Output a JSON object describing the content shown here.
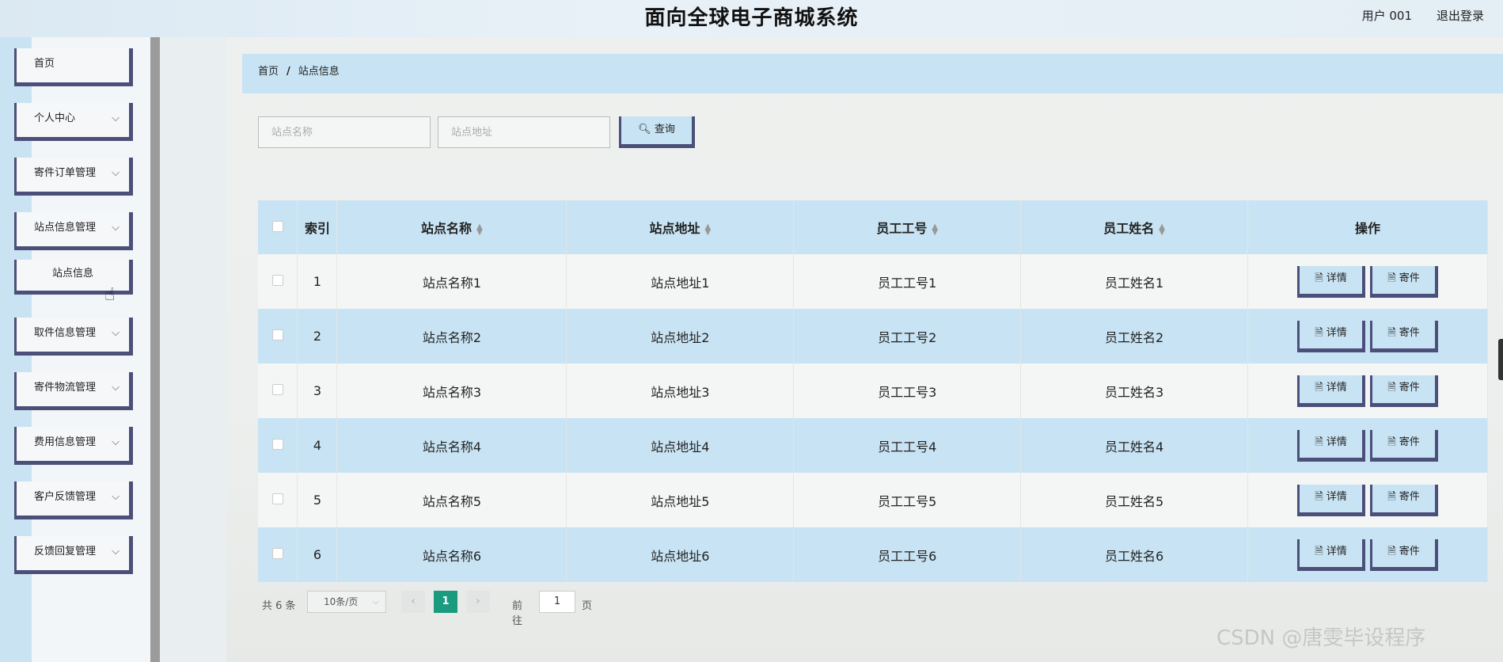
{
  "header": {
    "title": "面向全球电子商城系统",
    "user": "用户 001",
    "logout": "退出登录"
  },
  "sidebar": {
    "items": [
      {
        "label": "首页",
        "has_chevron": false
      },
      {
        "label": "个人中心",
        "has_chevron": true
      },
      {
        "label": "寄件订单管理",
        "has_chevron": true
      },
      {
        "label": "站点信息管理",
        "has_chevron": true
      },
      {
        "label": "站点信息",
        "sub": true
      },
      {
        "label": "取件信息管理",
        "has_chevron": true
      },
      {
        "label": "寄件物流管理",
        "has_chevron": true
      },
      {
        "label": "费用信息管理",
        "has_chevron": true
      },
      {
        "label": "客户反馈管理",
        "has_chevron": true
      },
      {
        "label": "反馈回复管理",
        "has_chevron": true
      }
    ]
  },
  "breadcrumb": {
    "home": "首页",
    "separator": "/",
    "current": "站点信息"
  },
  "search": {
    "name_placeholder": "站点名称",
    "address_placeholder": "站点地址",
    "query_label": "查询"
  },
  "table": {
    "headers": {
      "index": "索引",
      "name": "站点名称",
      "address": "站点地址",
      "staff_no": "员工工号",
      "staff_name": "员工姓名",
      "ops": "操作"
    },
    "rows": [
      {
        "index": "1",
        "name": "站点名称1",
        "address": "站点地址1",
        "staff_no": "员工工号1",
        "staff_name": "员工姓名1"
      },
      {
        "index": "2",
        "name": "站点名称2",
        "address": "站点地址2",
        "staff_no": "员工工号2",
        "staff_name": "员工姓名2"
      },
      {
        "index": "3",
        "name": "站点名称3",
        "address": "站点地址3",
        "staff_no": "员工工号3",
        "staff_name": "员工姓名3"
      },
      {
        "index": "4",
        "name": "站点名称4",
        "address": "站点地址4",
        "staff_no": "员工工号4",
        "staff_name": "员工姓名4"
      },
      {
        "index": "5",
        "name": "站点名称5",
        "address": "站点地址5",
        "staff_no": "员工工号5",
        "staff_name": "员工姓名5"
      },
      {
        "index": "6",
        "name": "站点名称6",
        "address": "站点地址6",
        "staff_no": "员工工号6",
        "staff_name": "员工姓名6"
      }
    ],
    "detail_label": "详情",
    "send_label": "寄件"
  },
  "pagination": {
    "total": "共 6 条",
    "page_size": "10条/页",
    "current_page": "1",
    "goto_label": "前往",
    "goto_value": "1",
    "unit": "页"
  },
  "watermark": "CSDN @唐雯毕设程序",
  "colors": {
    "accent_blue": "#c8e3f3",
    "button_border": "#4c4f7a",
    "page_active": "#1a9b7f"
  }
}
